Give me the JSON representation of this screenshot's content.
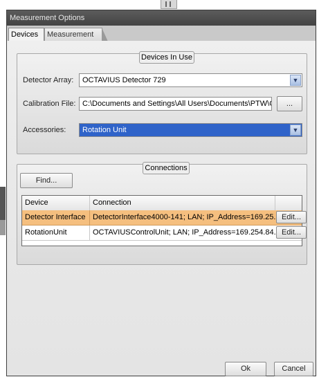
{
  "window": {
    "title": "Measurement Options"
  },
  "tabs": [
    {
      "label": "Devices",
      "active": true
    },
    {
      "label": "Measurement",
      "active": false
    }
  ],
  "devices_in_use": {
    "group_title": "Devices In Use",
    "detector_array": {
      "label": "Detector Array:",
      "value": "OCTAVIUS Detector 729"
    },
    "calibration_file": {
      "label": "Calibration File:",
      "value": "C:\\Documents and Settings\\All Users\\Documents\\PTW\\C",
      "browse_label": "..."
    },
    "accessories": {
      "label": "Accessories:",
      "value": "Rotation Unit"
    }
  },
  "connections": {
    "group_title": "Connections",
    "find_label": "Find...",
    "columns": [
      "Device",
      "Connection"
    ],
    "rows": [
      {
        "device": "Detector Interface",
        "connection": "DetectorInterface4000-141; LAN; IP_Address=169.25...",
        "edit_label": "Edit...",
        "selected": true
      },
      {
        "device": "RotationUnit",
        "connection": "OCTAVIUSControlUnit; LAN; IP_Address=169.254.84....",
        "edit_label": "Edit...",
        "selected": false
      }
    ]
  },
  "footer": {
    "ok_label": "Ok",
    "cancel_label": "Cancel"
  },
  "icons": {
    "dropdown": "chevron-down-icon"
  },
  "colors": {
    "selected_row": "#f5bf7f",
    "selected_field": "#2f63c9",
    "title_bar": "#4d4d4d"
  }
}
